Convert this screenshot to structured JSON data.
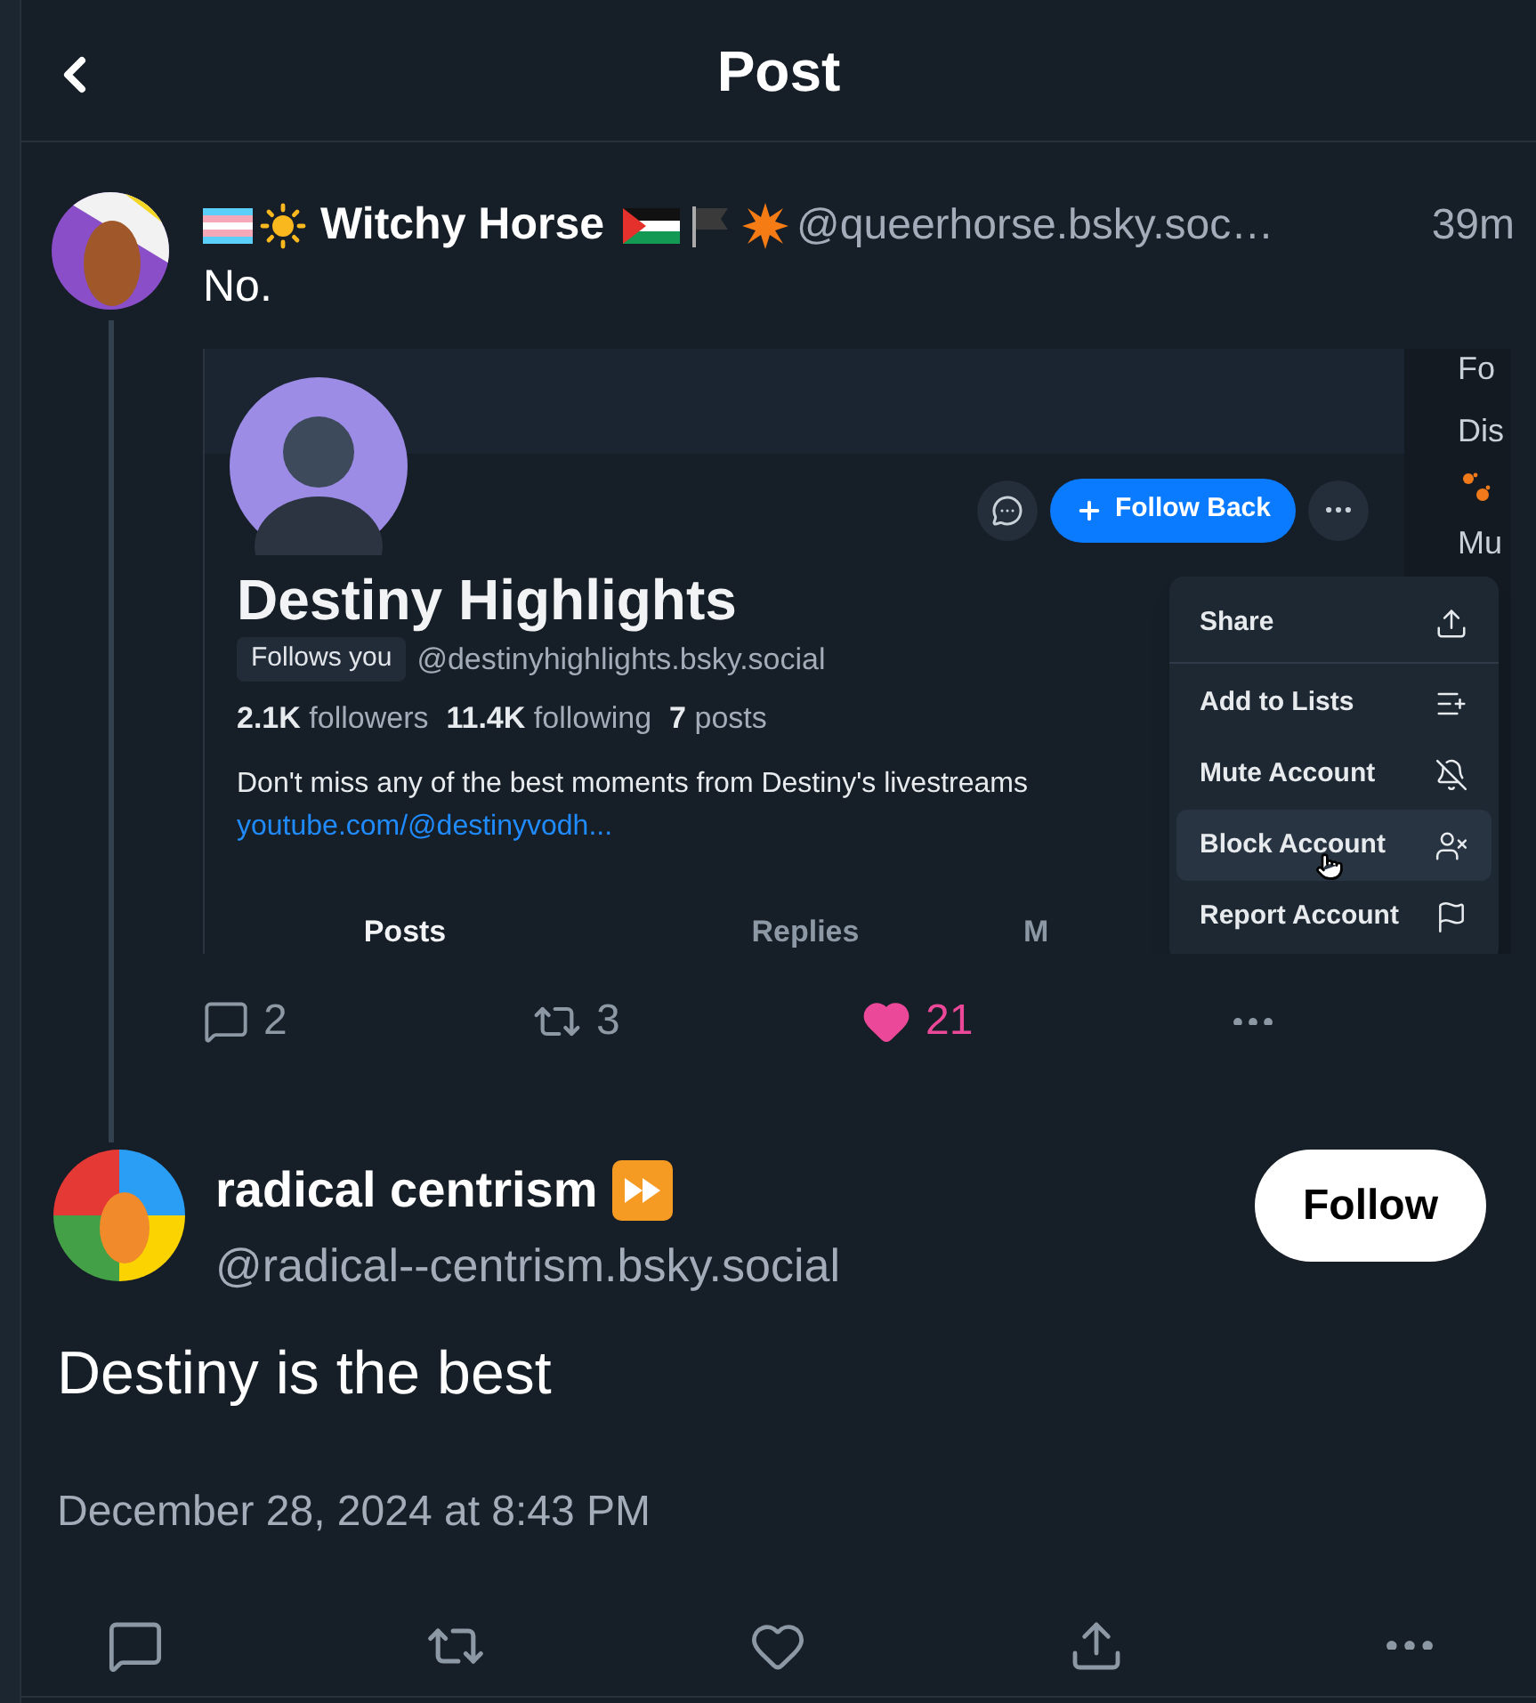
{
  "header": {
    "title": "Post"
  },
  "parent_post": {
    "author": "Witchy Horse",
    "handle": "@queerhorse.bsky.soc…",
    "time": "39m",
    "text": "No.",
    "embed": {
      "profile": {
        "name": "Destiny Highlights",
        "badge": "Follows you",
        "handle": "@destinyhighlights.bsky.social",
        "stats": [
          "**2.1K** followers",
          "**11.4K** following",
          "**7** posts"
        ],
        "bio": "Don't miss any of the best moments from Destiny's livestreams",
        "link": "youtube.com/@destinyvodh...",
        "follow_button": "Follow Back",
        "tabs": [
          {
            "label": "Posts",
            "selected": true
          },
          {
            "label": "Replies",
            "selected": false
          },
          {
            "label": "M",
            "selected": false
          }
        ]
      },
      "sidebar_fragments": [
        "Fo",
        "Dis",
        "Mu"
      ],
      "menu": [
        {
          "label": "Share",
          "kind": "share",
          "selected": false
        },
        {
          "label": "Add to Lists",
          "kind": "lists",
          "selected": false
        },
        {
          "label": "Mute Account",
          "kind": "mute",
          "selected": false
        },
        {
          "label": "Block Account",
          "kind": "block",
          "selected": true
        },
        {
          "label": "Report Account",
          "kind": "report",
          "selected": false
        }
      ]
    },
    "stats": {
      "replies": "2",
      "reposts": "3",
      "likes": "21",
      "liked": true
    }
  },
  "focused_post": {
    "author": "radical centrism",
    "handle": "@radical--centrism.bsky.social",
    "follow_button": "Follow",
    "text": "Destiny is the best",
    "date": "December 28, 2024 at 8:43 PM"
  }
}
